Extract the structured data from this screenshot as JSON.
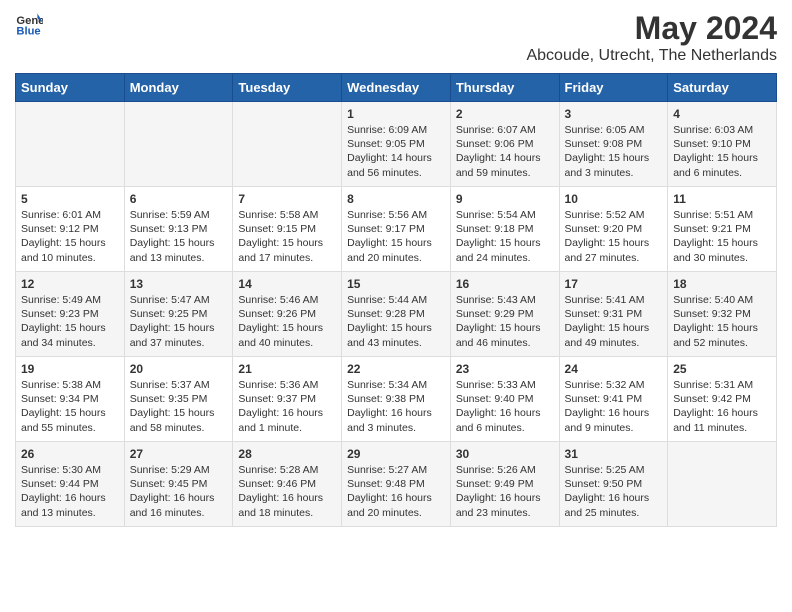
{
  "header": {
    "logo_general": "General",
    "logo_blue": "Blue",
    "title": "May 2024",
    "subtitle": "Abcoude, Utrecht, The Netherlands"
  },
  "days_of_week": [
    "Sunday",
    "Monday",
    "Tuesday",
    "Wednesday",
    "Thursday",
    "Friday",
    "Saturday"
  ],
  "weeks": [
    [
      {
        "day": "",
        "lines": []
      },
      {
        "day": "",
        "lines": []
      },
      {
        "day": "",
        "lines": []
      },
      {
        "day": "1",
        "lines": [
          "Sunrise: 6:09 AM",
          "Sunset: 9:05 PM",
          "Daylight: 14 hours",
          "and 56 minutes."
        ]
      },
      {
        "day": "2",
        "lines": [
          "Sunrise: 6:07 AM",
          "Sunset: 9:06 PM",
          "Daylight: 14 hours",
          "and 59 minutes."
        ]
      },
      {
        "day": "3",
        "lines": [
          "Sunrise: 6:05 AM",
          "Sunset: 9:08 PM",
          "Daylight: 15 hours",
          "and 3 minutes."
        ]
      },
      {
        "day": "4",
        "lines": [
          "Sunrise: 6:03 AM",
          "Sunset: 9:10 PM",
          "Daylight: 15 hours",
          "and 6 minutes."
        ]
      }
    ],
    [
      {
        "day": "5",
        "lines": [
          "Sunrise: 6:01 AM",
          "Sunset: 9:12 PM",
          "Daylight: 15 hours",
          "and 10 minutes."
        ]
      },
      {
        "day": "6",
        "lines": [
          "Sunrise: 5:59 AM",
          "Sunset: 9:13 PM",
          "Daylight: 15 hours",
          "and 13 minutes."
        ]
      },
      {
        "day": "7",
        "lines": [
          "Sunrise: 5:58 AM",
          "Sunset: 9:15 PM",
          "Daylight: 15 hours",
          "and 17 minutes."
        ]
      },
      {
        "day": "8",
        "lines": [
          "Sunrise: 5:56 AM",
          "Sunset: 9:17 PM",
          "Daylight: 15 hours",
          "and 20 minutes."
        ]
      },
      {
        "day": "9",
        "lines": [
          "Sunrise: 5:54 AM",
          "Sunset: 9:18 PM",
          "Daylight: 15 hours",
          "and 24 minutes."
        ]
      },
      {
        "day": "10",
        "lines": [
          "Sunrise: 5:52 AM",
          "Sunset: 9:20 PM",
          "Daylight: 15 hours",
          "and 27 minutes."
        ]
      },
      {
        "day": "11",
        "lines": [
          "Sunrise: 5:51 AM",
          "Sunset: 9:21 PM",
          "Daylight: 15 hours",
          "and 30 minutes."
        ]
      }
    ],
    [
      {
        "day": "12",
        "lines": [
          "Sunrise: 5:49 AM",
          "Sunset: 9:23 PM",
          "Daylight: 15 hours",
          "and 34 minutes."
        ]
      },
      {
        "day": "13",
        "lines": [
          "Sunrise: 5:47 AM",
          "Sunset: 9:25 PM",
          "Daylight: 15 hours",
          "and 37 minutes."
        ]
      },
      {
        "day": "14",
        "lines": [
          "Sunrise: 5:46 AM",
          "Sunset: 9:26 PM",
          "Daylight: 15 hours",
          "and 40 minutes."
        ]
      },
      {
        "day": "15",
        "lines": [
          "Sunrise: 5:44 AM",
          "Sunset: 9:28 PM",
          "Daylight: 15 hours",
          "and 43 minutes."
        ]
      },
      {
        "day": "16",
        "lines": [
          "Sunrise: 5:43 AM",
          "Sunset: 9:29 PM",
          "Daylight: 15 hours",
          "and 46 minutes."
        ]
      },
      {
        "day": "17",
        "lines": [
          "Sunrise: 5:41 AM",
          "Sunset: 9:31 PM",
          "Daylight: 15 hours",
          "and 49 minutes."
        ]
      },
      {
        "day": "18",
        "lines": [
          "Sunrise: 5:40 AM",
          "Sunset: 9:32 PM",
          "Daylight: 15 hours",
          "and 52 minutes."
        ]
      }
    ],
    [
      {
        "day": "19",
        "lines": [
          "Sunrise: 5:38 AM",
          "Sunset: 9:34 PM",
          "Daylight: 15 hours",
          "and 55 minutes."
        ]
      },
      {
        "day": "20",
        "lines": [
          "Sunrise: 5:37 AM",
          "Sunset: 9:35 PM",
          "Daylight: 15 hours",
          "and 58 minutes."
        ]
      },
      {
        "day": "21",
        "lines": [
          "Sunrise: 5:36 AM",
          "Sunset: 9:37 PM",
          "Daylight: 16 hours",
          "and 1 minute."
        ]
      },
      {
        "day": "22",
        "lines": [
          "Sunrise: 5:34 AM",
          "Sunset: 9:38 PM",
          "Daylight: 16 hours",
          "and 3 minutes."
        ]
      },
      {
        "day": "23",
        "lines": [
          "Sunrise: 5:33 AM",
          "Sunset: 9:40 PM",
          "Daylight: 16 hours",
          "and 6 minutes."
        ]
      },
      {
        "day": "24",
        "lines": [
          "Sunrise: 5:32 AM",
          "Sunset: 9:41 PM",
          "Daylight: 16 hours",
          "and 9 minutes."
        ]
      },
      {
        "day": "25",
        "lines": [
          "Sunrise: 5:31 AM",
          "Sunset: 9:42 PM",
          "Daylight: 16 hours",
          "and 11 minutes."
        ]
      }
    ],
    [
      {
        "day": "26",
        "lines": [
          "Sunrise: 5:30 AM",
          "Sunset: 9:44 PM",
          "Daylight: 16 hours",
          "and 13 minutes."
        ]
      },
      {
        "day": "27",
        "lines": [
          "Sunrise: 5:29 AM",
          "Sunset: 9:45 PM",
          "Daylight: 16 hours",
          "and 16 minutes."
        ]
      },
      {
        "day": "28",
        "lines": [
          "Sunrise: 5:28 AM",
          "Sunset: 9:46 PM",
          "Daylight: 16 hours",
          "and 18 minutes."
        ]
      },
      {
        "day": "29",
        "lines": [
          "Sunrise: 5:27 AM",
          "Sunset: 9:48 PM",
          "Daylight: 16 hours",
          "and 20 minutes."
        ]
      },
      {
        "day": "30",
        "lines": [
          "Sunrise: 5:26 AM",
          "Sunset: 9:49 PM",
          "Daylight: 16 hours",
          "and 23 minutes."
        ]
      },
      {
        "day": "31",
        "lines": [
          "Sunrise: 5:25 AM",
          "Sunset: 9:50 PM",
          "Daylight: 16 hours",
          "and 25 minutes."
        ]
      },
      {
        "day": "",
        "lines": []
      }
    ]
  ]
}
